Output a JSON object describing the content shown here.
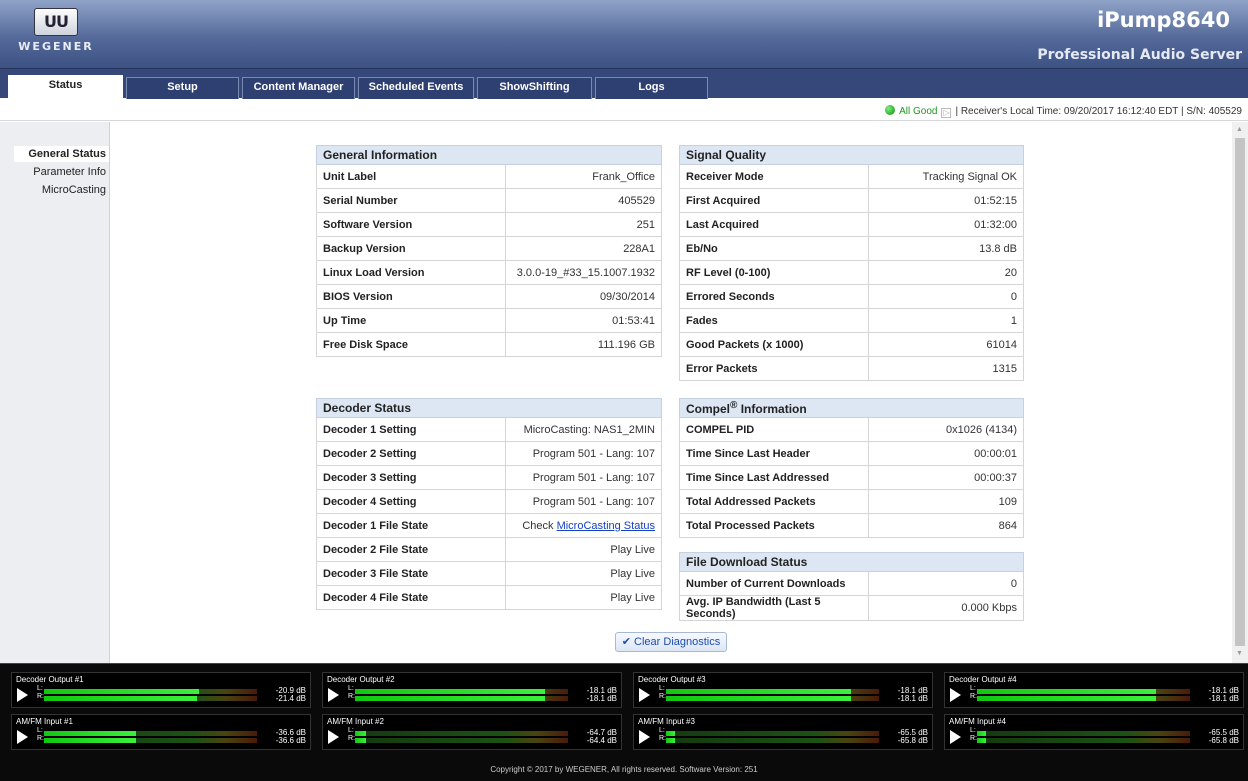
{
  "header": {
    "logo_mark": "UU",
    "logo_text": "WEGENER",
    "product": "iPump8640",
    "subtitle": "Professional Audio Server"
  },
  "tabs": [
    {
      "label": "Status"
    },
    {
      "label": "Setup"
    },
    {
      "label": "Content Manager"
    },
    {
      "label": "Scheduled Events"
    },
    {
      "label": "ShowShifting"
    },
    {
      "label": "Logs"
    }
  ],
  "status_bar": {
    "state": "All Good",
    "info": "| Receiver's Local Time: 09/20/2017 16:12:40 EDT | S/N: 405529"
  },
  "sidebar": {
    "items": [
      {
        "label": "General Status"
      },
      {
        "label": "Parameter Info"
      },
      {
        "label": "MicroCasting"
      }
    ]
  },
  "general_info": {
    "title": "General Information",
    "rows": [
      {
        "k": "Unit Label",
        "v": "Frank_Office"
      },
      {
        "k": "Serial Number",
        "v": "405529"
      },
      {
        "k": "Software Version",
        "v": "251"
      },
      {
        "k": "Backup Version",
        "v": "228A1"
      },
      {
        "k": "Linux Load Version",
        "v": "3.0.0-19_#33_15.1007.1932"
      },
      {
        "k": "BIOS Version",
        "v": "09/30/2014"
      },
      {
        "k": "Up Time",
        "v": "01:53:41"
      },
      {
        "k": "Free Disk Space",
        "v": "111.196 GB"
      }
    ]
  },
  "signal_quality": {
    "title": "Signal Quality",
    "rows": [
      {
        "k": "Receiver Mode",
        "v": "Tracking Signal OK"
      },
      {
        "k": "First Acquired",
        "v": "01:52:15"
      },
      {
        "k": "Last Acquired",
        "v": "01:32:00"
      },
      {
        "k": "Eb/No",
        "v": "13.8 dB"
      },
      {
        "k": "RF Level (0-100)",
        "v": "20"
      },
      {
        "k": "Errored Seconds",
        "v": "0"
      },
      {
        "k": "Fades",
        "v": "1"
      },
      {
        "k": "Good Packets (x 1000)",
        "v": "61014"
      },
      {
        "k": "Error Packets",
        "v": "1315"
      }
    ]
  },
  "decoder_status": {
    "title": "Decoder Status",
    "check_prefix": "Check ",
    "check_link": "MicroCasting Status",
    "rows": [
      {
        "k": "Decoder 1 Setting",
        "v": "MicroCasting: NAS1_2MIN"
      },
      {
        "k": "Decoder 2 Setting",
        "v": "Program 501 - Lang: 107"
      },
      {
        "k": "Decoder 3 Setting",
        "v": "Program 501 - Lang: 107"
      },
      {
        "k": "Decoder 4 Setting",
        "v": "Program 501 - Lang: 107"
      },
      {
        "k": "Decoder 1 File State",
        "v": ""
      },
      {
        "k": "Decoder 2 File State",
        "v": "Play Live"
      },
      {
        "k": "Decoder 3 File State",
        "v": "Play Live"
      },
      {
        "k": "Decoder 4 File State",
        "v": "Play Live"
      }
    ]
  },
  "compel": {
    "title_prefix": "Compel",
    "title_sup": "®",
    "title_suffix": " Information",
    "rows": [
      {
        "k": "COMPEL PID",
        "v": "0x1026 (4134)"
      },
      {
        "k": "Time Since Last Header",
        "v": "00:00:01"
      },
      {
        "k": "Time Since Last Addressed",
        "v": "00:00:37"
      },
      {
        "k": "Total Addressed Packets",
        "v": "109"
      },
      {
        "k": "Total Processed Packets",
        "v": "864"
      }
    ]
  },
  "file_download": {
    "title": "File Download Status",
    "rows": [
      {
        "k": "Number of Current Downloads",
        "v": "0"
      },
      {
        "k": "Avg. IP Bandwidth (Last 5 Seconds)",
        "v": "0.000 Kbps"
      }
    ]
  },
  "clear_button": "Clear Diagnostics",
  "meters": [
    {
      "title": "Decoder Output #1",
      "l_db": "-20.9 dB",
      "r_db": "-21.4 dB",
      "l_level": 0.73,
      "r_level": 0.72
    },
    {
      "title": "Decoder Output #2",
      "l_db": "-18.1 dB",
      "r_db": "-18.1 dB",
      "l_level": 0.89,
      "r_level": 0.89
    },
    {
      "title": "Decoder Output #3",
      "l_db": "-18.1 dB",
      "r_db": "-18.1 dB",
      "l_level": 0.87,
      "r_level": 0.87
    },
    {
      "title": "Decoder Output #4",
      "l_db": "-18.1 dB",
      "r_db": "-18.1 dB",
      "l_level": 0.84,
      "r_level": 0.84
    },
    {
      "title": "AM/FM Input #1",
      "l_db": "-36.6 dB",
      "r_db": "-36.6 dB",
      "l_level": 0.43,
      "r_level": 0.43
    },
    {
      "title": "AM/FM Input #2",
      "l_db": "-64.7 dB",
      "r_db": "-64.4 dB",
      "l_level": 0.05,
      "r_level": 0.05
    },
    {
      "title": "AM/FM Input #3",
      "l_db": "-65.5 dB",
      "r_db": "-65.8 dB",
      "l_level": 0.04,
      "r_level": 0.04
    },
    {
      "title": "AM/FM Input #4",
      "l_db": "-65.5 dB",
      "r_db": "-65.8 dB",
      "l_level": 0.04,
      "r_level": 0.04
    }
  ],
  "meter_labels": {
    "l": "L:",
    "r": "R:"
  },
  "footer": "Copyright © 2017 by WEGENER, All rights reserved. Software Version: 251"
}
